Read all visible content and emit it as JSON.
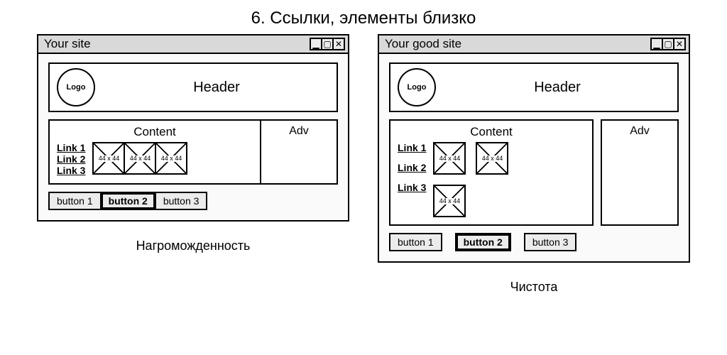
{
  "slide_title": "6. Ссылки, элементы близко",
  "thumb_label": "44 x 44",
  "left": {
    "window_title": "Your site",
    "caption": "Нагроможденность",
    "logo_text": "Logo",
    "header_text": "Header",
    "content_title": "Content",
    "adv_title": "Adv",
    "links": [
      "Link 1",
      "Link 2",
      "Link 3"
    ],
    "buttons": [
      "button 1",
      "button 2",
      "button 3"
    ],
    "active_button_index": 1
  },
  "right": {
    "window_title": "Your good site",
    "caption": "Чистота",
    "logo_text": "Logo",
    "header_text": "Header",
    "content_title": "Content",
    "adv_title": "Adv",
    "links": [
      "Link 1",
      "Link 2",
      "Link 3"
    ],
    "buttons": [
      "button 1",
      "button 2",
      "button 3"
    ],
    "active_button_index": 1
  }
}
